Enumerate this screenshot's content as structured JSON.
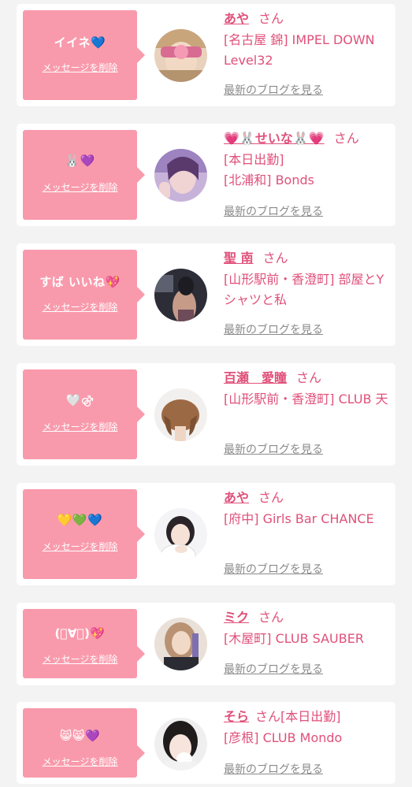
{
  "delete_label": "メッセージを削除",
  "blog_label": "最新のブログを見る",
  "accent_color": "#e0507a",
  "bubble_color": "#f99aac",
  "entries": [
    {
      "message": "イイネ💙",
      "name": "あや",
      "suffix": "さん",
      "lines": [
        "[名古屋 錦] IMPEL DOWN Level32"
      ]
    },
    {
      "message": "🐰💜",
      "name": "💗🐰せいな🐰💗",
      "suffix": "さん",
      "lines": [
        "[本日出勤]",
        "[北浦和] Bonds"
      ]
    },
    {
      "message": "すば いいね💖",
      "name": "聖 南",
      "suffix": "さん",
      "lines": [
        "[山形駅前・香澄町] 部屋とYシャツと私"
      ]
    },
    {
      "message": "🤍⚣",
      "name": "百瀬　愛瞳",
      "suffix": "さん",
      "lines": [
        "[山形駅前・香澄町] CLUB 天"
      ]
    },
    {
      "message": "💛💚💙",
      "name": "あや",
      "suffix": "さん",
      "lines": [
        "[府中] Girls Bar CHANCE"
      ]
    },
    {
      "message": "(ﾟ∀ﾟ)💖",
      "name": "ミク",
      "suffix": "さん",
      "lines": [
        "[木屋町] CLUB SAUBER"
      ]
    },
    {
      "message": "😸😸💜",
      "name": "そら",
      "suffix": "さん[本日出勤]",
      "lines": [
        "[彦根] CLUB Mondo"
      ]
    }
  ]
}
